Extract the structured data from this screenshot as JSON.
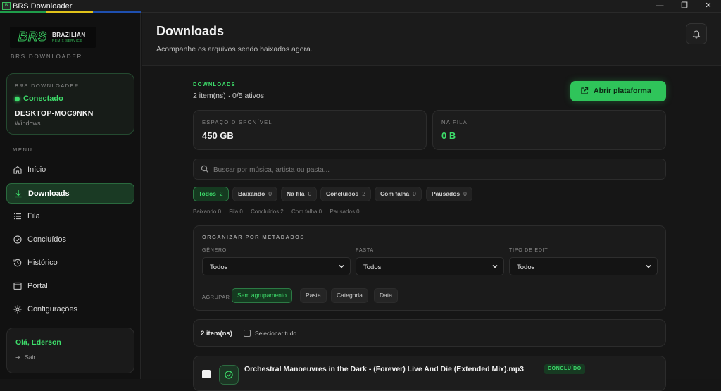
{
  "window": {
    "title": "BRS Downloader",
    "icon": "brs-app-icon",
    "minimize": "—",
    "maximize": "❐",
    "close": "✕"
  },
  "sidebar": {
    "logo": {
      "mark": "BRS",
      "brand": "BRAZILIAN",
      "tagline": "REMIX SERVICE"
    },
    "app_label": "BRS DOWNLOADER",
    "connection": {
      "heading": "BRS DOWNLOADER",
      "status": "Conectado",
      "host": "DESKTOP-MOC9NKN",
      "os": "Windows"
    },
    "menu_label": "MENU",
    "items": [
      {
        "label": "Início",
        "icon": "home-icon",
        "active": false
      },
      {
        "label": "Downloads",
        "icon": "download-icon",
        "active": true
      },
      {
        "label": "Fila",
        "icon": "queue-list-icon",
        "active": false
      },
      {
        "label": "Concluídos",
        "icon": "check-circle-icon",
        "active": false
      },
      {
        "label": "Histórico",
        "icon": "history-icon",
        "active": false
      },
      {
        "label": "Portal",
        "icon": "portal-window-icon",
        "active": false
      },
      {
        "label": "Configurações",
        "icon": "gear-icon",
        "active": false
      }
    ],
    "user": {
      "greeting": "Olá, Ederson",
      "logout": "Sair"
    }
  },
  "header": {
    "title": "Downloads",
    "subtitle": "Acompanhe os arquivos sendo baixados agora."
  },
  "section": {
    "label": "DOWNLOADS",
    "count": "2 item(ns) · 0/5 ativos",
    "open_button": "Abrir plataforma"
  },
  "stats": [
    {
      "label": "ESPAÇO DISPONÍVEL",
      "value": "450 GB",
      "color": "#f2f2f2"
    },
    {
      "label": "NA FILA",
      "value": "0 B",
      "color": "#3ddc6a"
    }
  ],
  "search": {
    "placeholder": "Buscar por música, artista ou pasta..."
  },
  "filters": [
    {
      "label": "Todos",
      "count": "2",
      "active": true
    },
    {
      "label": "Baixando",
      "count": "0",
      "active": false
    },
    {
      "label": "Na fila",
      "count": "0",
      "active": false
    },
    {
      "label": "Concluídos",
      "count": "2",
      "active": false
    },
    {
      "label": "Com falha",
      "count": "0",
      "active": false
    },
    {
      "label": "Pausados",
      "count": "0",
      "active": false
    }
  ],
  "stats_line": [
    "Baixando 0",
    "Fila 0",
    "Concluídos 2",
    "Com falha 0",
    "Pausados 0"
  ],
  "organize": {
    "title": "ORGANIZAR POR METADADOS",
    "fields": [
      {
        "label": "GÊNERO",
        "value": "Todos"
      },
      {
        "label": "PASTA",
        "value": "Todos"
      },
      {
        "label": "TIPO DE EDIT",
        "value": "Todos"
      }
    ],
    "group_label": "AGRUPAR",
    "groups": [
      {
        "label": "Sem agrupamento",
        "active": true
      },
      {
        "label": "Pasta",
        "active": false
      },
      {
        "label": "Categoria",
        "active": false
      },
      {
        "label": "Data",
        "active": false
      }
    ]
  },
  "list": {
    "count": "2 item(ns)",
    "select_all": "Selecionar tudo"
  },
  "downloads": [
    {
      "title": "Orchestral Manoeuvres in the Dark - (Forever) Live And Die (Extended Mix).mp3",
      "status": "CONCLUÍDO"
    }
  ]
}
